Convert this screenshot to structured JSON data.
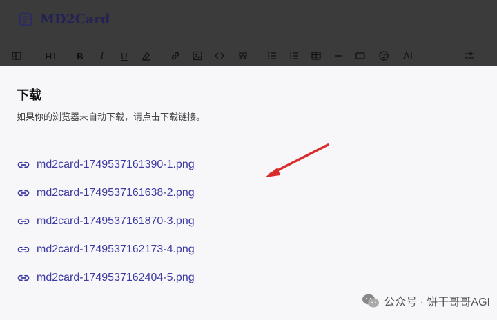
{
  "app": {
    "name": "MD2Card"
  },
  "toolbar": {
    "items": [
      {
        "name": "sidebar-toggle-icon"
      },
      {
        "name": "heading-icon",
        "label": "H1"
      },
      {
        "name": "bold-icon",
        "label": "B"
      },
      {
        "name": "italic-icon",
        "label": "I"
      },
      {
        "name": "underline-icon",
        "label": "U"
      },
      {
        "name": "strikethrough-icon"
      },
      {
        "name": "link-icon"
      },
      {
        "name": "image-icon"
      },
      {
        "name": "code-icon"
      },
      {
        "name": "quote-icon"
      },
      {
        "name": "bullet-list-icon"
      },
      {
        "name": "numbered-list-icon"
      },
      {
        "name": "table-icon"
      },
      {
        "name": "horizontal-rule-icon"
      },
      {
        "name": "card-icon"
      },
      {
        "name": "emoji-icon"
      },
      {
        "name": "ai-icon",
        "label": "AI"
      },
      {
        "name": "settings-sliders-icon"
      }
    ]
  },
  "download": {
    "title": "下载",
    "message": "如果你的浏览器未自动下载，请点击下载链接。",
    "files": [
      "md2card-1749537161390-1.png",
      "md2card-1749537161638-2.png",
      "md2card-1749537161870-3.png",
      "md2card-1749537162173-4.png",
      "md2card-1749537162404-5.png"
    ]
  },
  "annotation": {
    "arrow_color": "#d92b2b"
  },
  "watermark": {
    "text": "公众号 · 饼干哥哥AGI"
  },
  "colors": {
    "accent": "#3d3aa0",
    "header_bg": "#3b3b3c",
    "panel_bg": "#f7f7fa"
  }
}
